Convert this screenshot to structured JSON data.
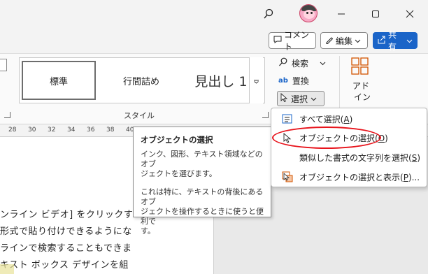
{
  "titlebar": {
    "search_icon": "search-icon",
    "minimize_icon": "minimize-icon",
    "maximize_icon": "maximize-icon",
    "close_icon": "close-icon"
  },
  "commands": {
    "comment_label": "コメント",
    "edit_label": "編集",
    "share_label": "共有"
  },
  "ribbon": {
    "styles": {
      "items": [
        "標準",
        "行間詰め",
        "見出し 1"
      ],
      "group_label": "スタイル"
    },
    "editing": {
      "find_label": "検索",
      "replace_label": "置換",
      "select_label": "選択"
    },
    "addin_label_1": "アド",
    "addin_label_2": "イン"
  },
  "ruler": {
    "ticks": [
      "28",
      "30",
      "32",
      "34",
      "36",
      "38",
      "40"
    ]
  },
  "document": {
    "lines": [
      "ンライン ビデオ] をクリックす",
      "形式で貼り付けできるようにな",
      "ラインで検索することもできま",
      "キスト ボックス デザインを組"
    ]
  },
  "tooltip": {
    "title": "オブジェクトの選択",
    "para1_l1": "インク、図形、テキスト領域などのオブ",
    "para1_l2": "ジェクトを選びます。",
    "para2_l1": "これは特に、テキストの背後にあるオブ",
    "para2_l2": "ジェクトを操作するときに使うと便利で",
    "para2_l3": "す。"
  },
  "menu": {
    "items": [
      {
        "label_pre": "すべて選択(",
        "key": "A",
        "label_post": ")"
      },
      {
        "label_pre": "オブジェクトの選択(",
        "key": "O",
        "label_post": ")"
      },
      {
        "label_pre": "類似した書式の文字列を選択(",
        "key": "S",
        "label_post": ")"
      },
      {
        "label_pre": "オブジェクトの選択と表示(",
        "key": "P",
        "label_post": ")..."
      }
    ]
  },
  "colors": {
    "accent": "#1a64c8",
    "highlight_oval": "#e8141c"
  }
}
